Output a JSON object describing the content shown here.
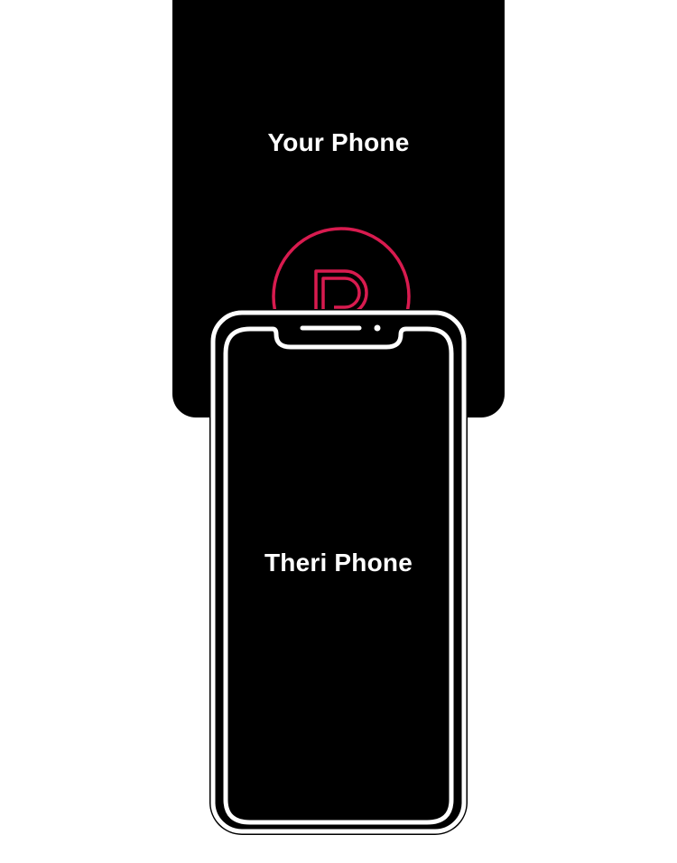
{
  "your_phone": {
    "label": "Your Phone"
  },
  "their_phone": {
    "label": "Theri Phone"
  },
  "colors": {
    "card": "#000000",
    "outline": "#ffffff",
    "accent": "#d81b4f"
  },
  "icons": {
    "logo": "p-logo-icon"
  }
}
